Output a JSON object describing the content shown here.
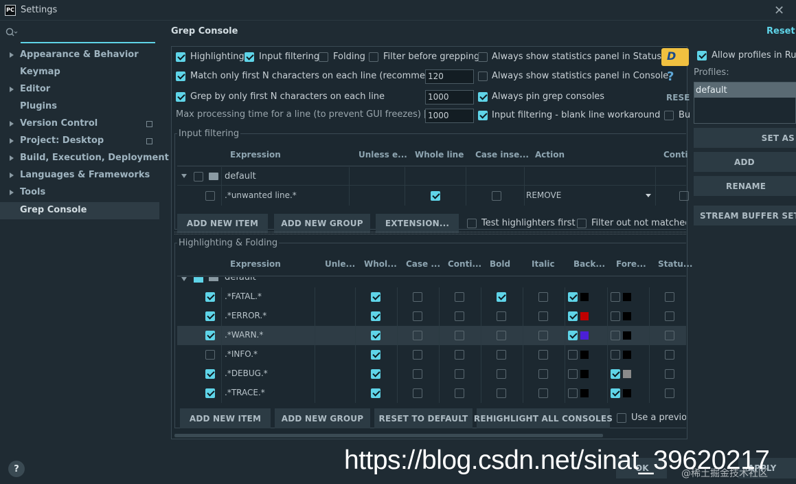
{
  "window": {
    "title": "Settings"
  },
  "sidebar": {
    "items": [
      {
        "label": "Appearance & Behavior"
      },
      {
        "label": "Keymap"
      },
      {
        "label": "Editor"
      },
      {
        "label": "Plugins"
      },
      {
        "label": "Version Control"
      },
      {
        "label": "Project: Desktop"
      },
      {
        "label": "Build, Execution, Deployment"
      },
      {
        "label": "Languages & Frameworks"
      },
      {
        "label": "Tools"
      },
      {
        "label": "Grep Console"
      }
    ]
  },
  "header": {
    "title": "Grep Console",
    "reset": "Reset"
  },
  "options": {
    "highlighting": "Highlighting",
    "input_filtering": "Input filtering",
    "folding": "Folding",
    "filter_before": "Filter before grepping",
    "stats_status_bar": "Always show statistics panel in Status Bar",
    "match_first_n": "Match only first N characters on each line (recommended)",
    "match_first_n_value": "120",
    "stats_console": "Always show statistics panel in Console",
    "grep_first_n": "Grep by only first N characters on each line",
    "grep_first_n_value": "1000",
    "pin_consoles": "Always pin grep consoles",
    "max_time": "Max processing time for a line (to prevent GUI freezes) [ms]",
    "max_time_value": "1000",
    "blank_line": "Input filtering - blank line workaround",
    "reset_partial": "RESE",
    "bu_partial": "Bu"
  },
  "input_filtering": {
    "title": "Input filtering",
    "columns": [
      "Expression",
      "Unless e...",
      "Whole line",
      "Case inse...",
      "Action",
      "Conti"
    ],
    "group": "default",
    "row": {
      "expression": ".*unwanted line.*",
      "action": "REMOVE"
    },
    "buttons": {
      "add_item": "ADD NEW ITEM",
      "add_group": "ADD NEW GROUP",
      "extension": "EXTENSION..."
    },
    "test_highlighters": "Test highlighters first",
    "filter_out": "Filter out not matched li"
  },
  "highlighting": {
    "title": "Highlighting & Folding",
    "columns": [
      "Expression",
      "Unle...",
      "Whol...",
      "Case ...",
      "Conti...",
      "Bold",
      "Italic",
      "Back...",
      "Fore...",
      "Statu..."
    ],
    "group": "default",
    "rows": [
      {
        "expression": ".*FATAL.*",
        "enabled": true,
        "whole": true,
        "bold": true,
        "bg_on": true,
        "bg_color": "#000000",
        "fg_on": false,
        "fg_color": "#000000"
      },
      {
        "expression": ".*ERROR.*",
        "enabled": true,
        "whole": true,
        "bold": false,
        "bg_on": true,
        "bg_color": "#c00000",
        "fg_on": false,
        "fg_color": "#000000"
      },
      {
        "expression": ".*WARN.*",
        "enabled": true,
        "whole": true,
        "bold": false,
        "bg_on": true,
        "bg_color": "#4b1fd6",
        "fg_on": false,
        "fg_color": "#000000"
      },
      {
        "expression": ".*INFO.*",
        "enabled": false,
        "whole": true,
        "bold": false,
        "bg_on": false,
        "bg_color": "#000000",
        "fg_on": false,
        "fg_color": "#000000"
      },
      {
        "expression": ".*DEBUG.*",
        "enabled": true,
        "whole": true,
        "bold": false,
        "bg_on": false,
        "bg_color": "#000000",
        "fg_on": true,
        "fg_color": "#8a8a8a"
      },
      {
        "expression": ".*TRACE.*",
        "enabled": true,
        "whole": true,
        "bold": false,
        "bg_on": false,
        "bg_color": "#000000",
        "fg_on": true,
        "fg_color": "#000000"
      }
    ],
    "buttons": {
      "add_item": "ADD NEW ITEM",
      "add_group": "ADD NEW GROUP",
      "reset_default": "RESET TO DEFAULT",
      "rehighlight": "REHIGHLIGHT ALL CONSOLES"
    },
    "use_previous": "Use a previou"
  },
  "profiles": {
    "allow_run": "Allow profiles in Run",
    "label": "Profiles:",
    "selected": "default",
    "set_as": "SET AS",
    "add": "ADD",
    "rename": "RENAME",
    "stream_buffer": "STREAM BUFFER SETTI"
  },
  "footer": {
    "help": "?",
    "ok_partial": "OK",
    "apply_partial": "APPLY"
  },
  "watermark": "https://blog.csdn.net/sinat_39620217",
  "watermark_small": "@稀土掘金技术社区",
  "colors": {
    "accent": "#5fd4e8",
    "background": "#1f2b33",
    "sidebar_selected": "#2e3c45"
  }
}
